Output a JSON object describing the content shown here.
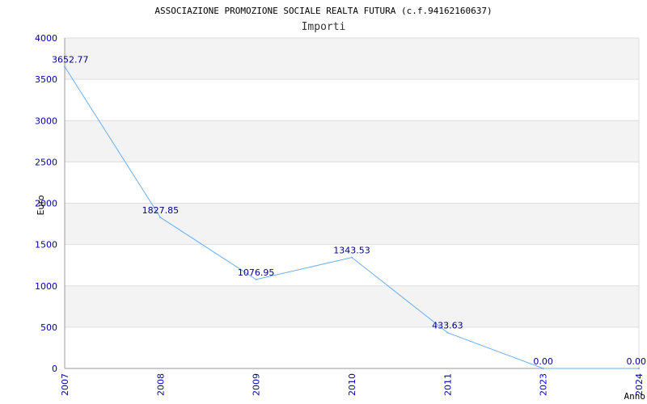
{
  "chart_data": {
    "type": "line",
    "title": "ASSOCIAZIONE PROMOZIONE SOCIALE REALTA FUTURA (c.f.94162160637)",
    "subtitle": "Importi",
    "xlabel": "Anno",
    "ylabel": "Euro",
    "categories": [
      "2007",
      "2008",
      "2009",
      "2010",
      "2011",
      "2023",
      "2024"
    ],
    "values": [
      3652.77,
      1827.85,
      1076.95,
      1343.53,
      433.63,
      0.0,
      0.0
    ],
    "value_labels": [
      "3652.77",
      "1827.85",
      "1076.95",
      "1343.53",
      "433.63",
      "0.00",
      "0.00"
    ],
    "yticks": [
      "0",
      "500",
      "1000",
      "1500",
      "2000",
      "2500",
      "3000",
      "3500",
      "4000"
    ],
    "ylim": [
      0,
      4000
    ],
    "grid": true,
    "legend": "none",
    "colors": {
      "line": "#6aaef0",
      "axis_text": "#0000aa",
      "label_text": "#000080",
      "band": "#f3f3f3",
      "gridline": "#dddddd"
    }
  }
}
